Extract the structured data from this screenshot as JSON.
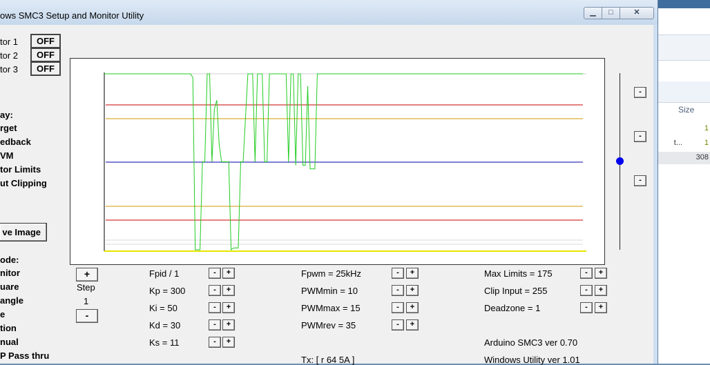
{
  "window": {
    "title": "ows SMC3 Setup and Monitor Utility",
    "controls": {
      "minimize": "▁",
      "maximize": "□",
      "close": "✕"
    }
  },
  "motors": [
    {
      "label": "tor 1",
      "state": "OFF"
    },
    {
      "label": "tor 2",
      "state": "OFF"
    },
    {
      "label": "tor 3",
      "state": "OFF"
    }
  ],
  "display": {
    "header": "ay:",
    "items": [
      "rget",
      "edback",
      "VM",
      "tor Limits",
      "ut Clipping"
    ],
    "save_label": "ve Image"
  },
  "mode": {
    "header": "ode:",
    "items": [
      "nitor",
      "uare",
      "angle",
      "e",
      "tion",
      "nual",
      "P Pass thru"
    ]
  },
  "step": {
    "plus": "+",
    "label": "Step",
    "value": "1",
    "minus": "-"
  },
  "pid": {
    "fpid": "Fpid / 1",
    "kp": "Kp = 300",
    "ki": "Ki = 50",
    "kd": "Kd = 30",
    "ks": "Ks = 11"
  },
  "pwm": {
    "fpwm": "Fpwm = 25kHz",
    "pwmmin": "PWMmin = 10",
    "pwmmax": "PWMmax = 15",
    "pwmrev": "PWMrev = 35"
  },
  "limits": {
    "max": "Max Limits = 175",
    "clip": "Clip Input = 255",
    "deadzone": "Deadzone = 1"
  },
  "footer": {
    "tx": "Tx: [ r 64 5A ]",
    "arduino": "Arduino SMC3 ver 0.70",
    "utility": "Windows Utility ver 1.01"
  },
  "adjust": {
    "minus": "-",
    "plus": "+"
  },
  "scale_buttons": [
    "-",
    "-",
    "-"
  ],
  "background_window": {
    "column": "Size",
    "rows": [
      "1",
      "1",
      "308"
    ],
    "fragment": "t..."
  },
  "colors": {
    "signal": "#22cc22",
    "outer_limit": "#cc0000",
    "clip": "#cc9900",
    "center": "#0000aa",
    "baseline": "#e6e600",
    "slider_knob": "#0000ee"
  },
  "chart_data": {
    "type": "line",
    "series": [
      {
        "values_relative": [
          [
            0,
            1
          ],
          [
            0.18,
            1
          ],
          [
            0.185,
            0.98
          ],
          [
            0.19,
            0
          ],
          [
            0.2,
            0
          ],
          [
            0.205,
            0.5
          ],
          [
            0.21,
            0.5
          ],
          [
            0.215,
            1
          ],
          [
            0.22,
            1
          ],
          [
            0.225,
            0.5
          ],
          [
            0.23,
            0.8
          ],
          [
            0.235,
            0.85
          ],
          [
            0.24,
            0.6
          ],
          [
            0.245,
            0.5
          ],
          [
            0.26,
            0.5
          ],
          [
            0.265,
            0
          ],
          [
            0.27,
            0.01
          ],
          [
            0.28,
            0.01
          ],
          [
            0.285,
            0.5
          ],
          [
            0.29,
            0.5
          ],
          [
            0.3,
            1
          ],
          [
            0.31,
            1
          ],
          [
            0.315,
            0.5
          ],
          [
            0.32,
            1
          ],
          [
            0.33,
            1
          ],
          [
            0.335,
            0.5
          ],
          [
            0.34,
            0.5
          ],
          [
            0.345,
            1
          ],
          [
            0.38,
            1
          ],
          [
            0.385,
            0.5
          ],
          [
            0.39,
            1
          ],
          [
            0.395,
            1
          ],
          [
            0.4,
            0.48
          ],
          [
            0.405,
            1
          ],
          [
            0.41,
            1
          ],
          [
            0.415,
            0.48
          ],
          [
            0.42,
            0.48
          ],
          [
            0.425,
            0.93
          ],
          [
            0.43,
            0.46
          ],
          [
            0.44,
            0.46
          ],
          [
            0.445,
            1
          ],
          [
            1,
            1
          ]
        ]
      }
    ]
  }
}
